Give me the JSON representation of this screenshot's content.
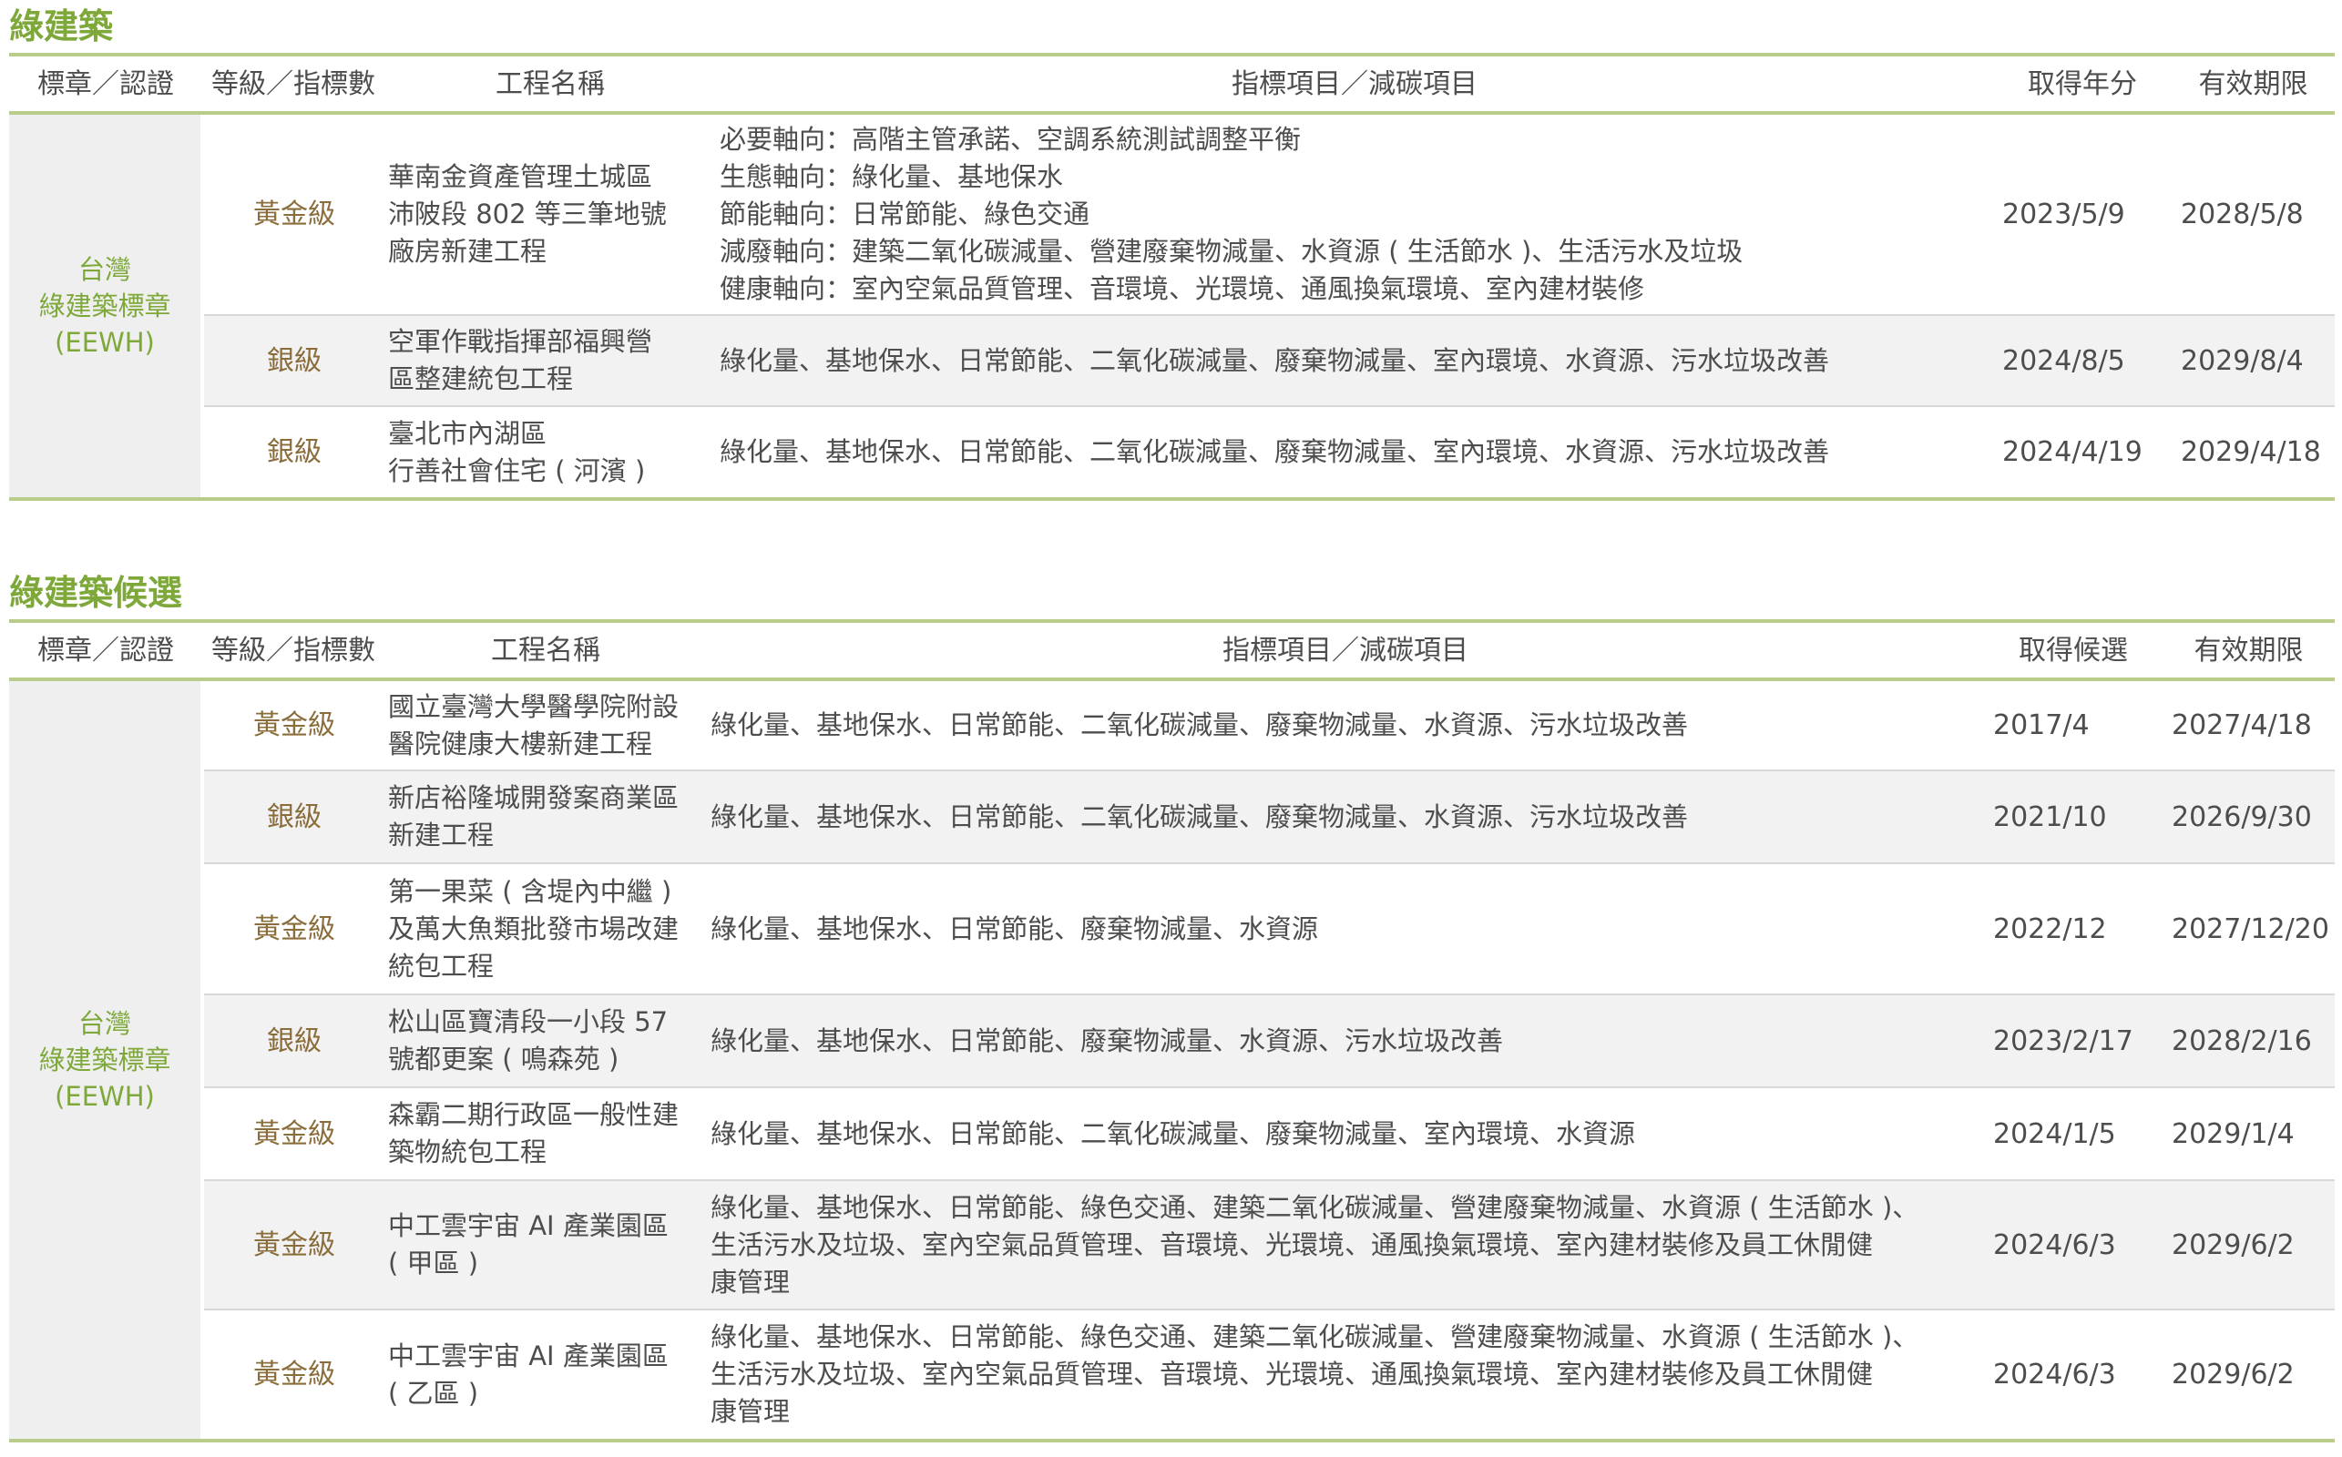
{
  "section1": {
    "title": "綠建築",
    "headers": [
      "標章／認證",
      "等級／指標數",
      "工程名稱",
      "指標項目／減碳項目",
      "取得年分",
      "有效期限"
    ],
    "badge": [
      "台灣",
      "綠建築標章",
      "(EEWH)"
    ],
    "rows": [
      {
        "grade": "黃金級",
        "name": [
          "華南金資產管理土城區",
          "沛陂段 802 等三筆地號",
          "廠房新建工程"
        ],
        "items": [
          "必要軸向：高階主管承諾、空調系統測試調整平衡",
          "生態軸向：綠化量、基地保水",
          "節能軸向：日常節能、綠色交通",
          "減廢軸向：建築二氧化碳減量、營建廢棄物減量、水資源 ( 生活節水 )、生活污水及垃圾",
          "健康軸向：室內空氣品質管理、音環境、光環境、通風換氣環境、室內建材裝修"
        ],
        "obtained": "2023/5/9",
        "expiry": "2028/5/8"
      },
      {
        "grade": "銀級",
        "name": [
          "空軍作戰指揮部福興營",
          "區整建統包工程"
        ],
        "items": [
          "綠化量、基地保水、日常節能、二氧化碳減量、廢棄物減量、室內環境、水資源、污水垃圾改善"
        ],
        "obtained": "2024/8/5",
        "expiry": "2029/8/4"
      },
      {
        "grade": "銀級",
        "name": [
          "臺北市內湖區",
          "行善社會住宅 ( 河濱 )"
        ],
        "items": [
          "綠化量、基地保水、日常節能、二氧化碳減量、廢棄物減量、室內環境、水資源、污水垃圾改善"
        ],
        "obtained": "2024/4/19",
        "expiry": "2029/4/18"
      }
    ]
  },
  "section2": {
    "title": "綠建築候選",
    "headers": [
      "標章／認證",
      "等級／指標數",
      "工程名稱",
      "指標項目／減碳項目",
      "取得候選",
      "有效期限"
    ],
    "badge": [
      "台灣",
      "綠建築標章",
      "(EEWH)"
    ],
    "rows": [
      {
        "grade": "黃金級",
        "name": [
          "國立臺灣大學醫學院附設",
          "醫院健康大樓新建工程"
        ],
        "items": [
          "綠化量、基地保水、日常節能、二氧化碳減量、廢棄物減量、水資源、污水垃圾改善"
        ],
        "obtained": "2017/4",
        "expiry": "2027/4/18"
      },
      {
        "grade": "銀級",
        "name": [
          "新店裕隆城開發案商業區",
          "新建工程"
        ],
        "items": [
          "綠化量、基地保水、日常節能、二氧化碳減量、廢棄物減量、水資源、污水垃圾改善"
        ],
        "obtained": "2021/10",
        "expiry": "2026/9/30"
      },
      {
        "grade": "黃金級",
        "name": [
          "第一果菜 ( 含堤內中繼 )",
          "及萬大魚類批發市場改建",
          "統包工程"
        ],
        "items": [
          "綠化量、基地保水、日常節能、廢棄物減量、水資源"
        ],
        "obtained": "2022/12",
        "expiry": "2027/12/20"
      },
      {
        "grade": "銀級",
        "name": [
          "松山區寶清段一小段 57",
          "號都更案 ( 鳴森苑 )"
        ],
        "items": [
          "綠化量、基地保水、日常節能、廢棄物減量、水資源、污水垃圾改善"
        ],
        "obtained": "2023/2/17",
        "expiry": "2028/2/16"
      },
      {
        "grade": "黃金級",
        "name": [
          "森霸二期行政區一般性建",
          "築物統包工程"
        ],
        "items": [
          "綠化量、基地保水、日常節能、二氧化碳減量、廢棄物減量、室內環境、水資源"
        ],
        "obtained": "2024/1/5",
        "expiry": "2029/1/4"
      },
      {
        "grade": "黃金級",
        "name": [
          "中工雲宇宙 AI 產業園區",
          "( 甲區 )"
        ],
        "items": [
          "綠化量、基地保水、日常節能、綠色交通、建築二氧化碳減量、營建廢棄物減量、水資源 ( 生活節水 )、",
          "生活污水及垃圾、室內空氣品質管理、音環境、光環境、通風換氣環境、室內建材裝修及員工休閒健",
          "康管理"
        ],
        "obtained": "2024/6/3",
        "expiry": "2029/6/2"
      },
      {
        "grade": "黃金級",
        "name": [
          "中工雲宇宙 AI 產業園區",
          "( 乙區 )"
        ],
        "items": [
          "綠化量、基地保水、日常節能、綠色交通、建築二氧化碳減量、營建廢棄物減量、水資源 ( 生活節水 )、",
          "生活污水及垃圾、室內空氣品質管理、音環境、光環境、通風換氣環境、室內建材裝修及員工休閒健",
          "康管理"
        ],
        "obtained": "2024/6/3",
        "expiry": "2029/6/2"
      }
    ]
  }
}
